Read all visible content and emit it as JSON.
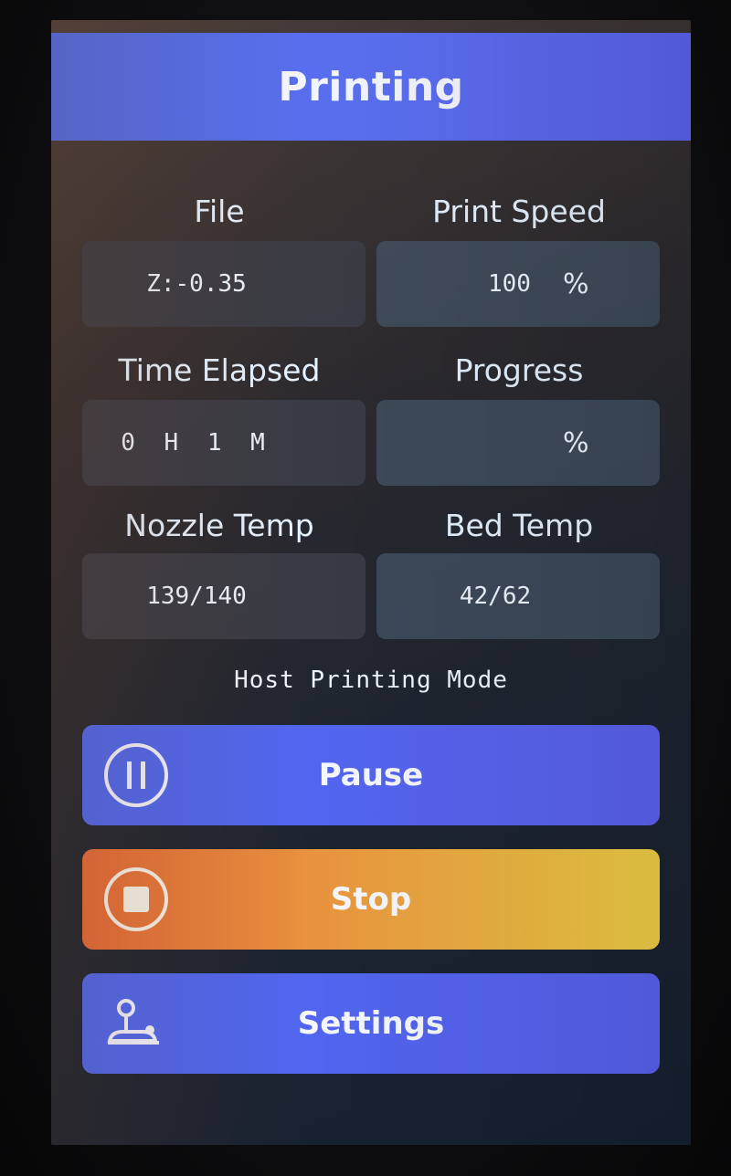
{
  "header": {
    "title": "Printing"
  },
  "fields": {
    "file": {
      "label": "File",
      "value": "Z:-0.35"
    },
    "print_speed": {
      "label": "Print Speed",
      "value": "100",
      "unit": "%"
    },
    "time_elapsed": {
      "label": "Time Elapsed",
      "value": "0 H 1 M"
    },
    "progress": {
      "label": "Progress",
      "value": "",
      "unit": "%"
    },
    "nozzle_temp": {
      "label": "Nozzle Temp",
      "value": "139/140"
    },
    "bed_temp": {
      "label": "Bed Temp",
      "value": "42/62"
    }
  },
  "status": {
    "mode": "Host Printing Mode"
  },
  "buttons": {
    "pause": {
      "label": "Pause",
      "icon": "pause-icon"
    },
    "stop": {
      "label": "Stop",
      "icon": "stop-icon"
    },
    "settings": {
      "label": "Settings",
      "icon": "joystick-icon"
    }
  },
  "colors": {
    "header": "#5a6ff0",
    "pause_button": "#5262ef",
    "stop_button_start": "#e46a38",
    "stop_button_end": "#f0cf45",
    "settings_button": "#5262ef"
  }
}
